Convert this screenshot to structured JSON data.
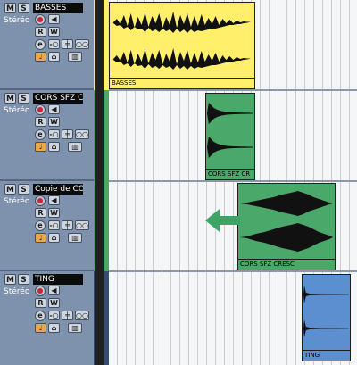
{
  "tracks": [
    {
      "mute": "M",
      "solo": "S",
      "name": "BASSES",
      "channel": "Stéréo",
      "read": "R",
      "write": "W",
      "edit": "e",
      "event": "BASSES",
      "color": "#ffef6a"
    },
    {
      "mute": "M",
      "solo": "S",
      "name": "CORS SFZ CRI",
      "channel": "Stéréo",
      "read": "R",
      "write": "W",
      "edit": "e",
      "event": "CORS SFZ CR",
      "color": "#4aa86b"
    },
    {
      "mute": "M",
      "solo": "S",
      "name": "Copie de CORS",
      "channel": "Stéréo",
      "read": "R",
      "write": "W",
      "edit": "e",
      "event": "CORS SFZ CRESC",
      "color": "#4aa86b"
    },
    {
      "mute": "M",
      "solo": "S",
      "name": "TING",
      "channel": "Stéréo",
      "read": "R",
      "write": "W",
      "edit": "e",
      "event": "TING",
      "color": "#5b8fd0"
    }
  ],
  "colors": {
    "arrow": "#3ea565",
    "panel": "#7f92ad"
  },
  "icons": [
    "record-icon",
    "speaker-icon",
    "insert-icon",
    "send-icon",
    "eq-icon",
    "channel-icon",
    "musical-time-icon",
    "lock-icon",
    "lane-icon"
  ]
}
